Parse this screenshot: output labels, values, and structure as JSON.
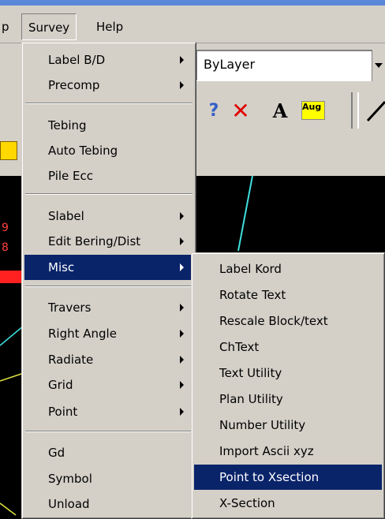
{
  "menubar": {
    "items": [
      {
        "label": "Survey"
      },
      {
        "label": "Help"
      }
    ],
    "partial_left": "p"
  },
  "toolbar": {
    "layer_value": "ByLayer",
    "aug_icon_text": "Aug"
  },
  "survey_menu": {
    "items": [
      {
        "label": "Label B/D",
        "submenu": true
      },
      {
        "label": "Precomp",
        "submenu": true
      },
      {
        "label": "Tebing",
        "submenu": false
      },
      {
        "label": "Auto Tebing",
        "submenu": false
      },
      {
        "label": "Pile Ecc",
        "submenu": false
      },
      {
        "label": "Slabel",
        "submenu": true
      },
      {
        "label": "Edit Bering/Dist",
        "submenu": true
      },
      {
        "label": "Misc",
        "submenu": true,
        "highlighted": true
      },
      {
        "label": "Travers",
        "submenu": true
      },
      {
        "label": "Right Angle",
        "submenu": true
      },
      {
        "label": "Radiate",
        "submenu": true
      },
      {
        "label": "Grid",
        "submenu": true
      },
      {
        "label": "Point",
        "submenu": true
      },
      {
        "label": "Gd",
        "submenu": false
      },
      {
        "label": "Symbol",
        "submenu": false
      },
      {
        "label": "Unload",
        "submenu": false
      }
    ]
  },
  "misc_submenu": {
    "items": [
      {
        "label": "Label Kord"
      },
      {
        "label": "Rotate Text"
      },
      {
        "label": "Rescale Block/text"
      },
      {
        "label": "ChText"
      },
      {
        "label": "Text Utility"
      },
      {
        "label": "Plan Utility"
      },
      {
        "label": "Number Utility"
      },
      {
        "label": "Import Ascii xyz"
      },
      {
        "label": "Point to Xsection",
        "highlighted": true
      },
      {
        "label": "X-Section"
      }
    ]
  },
  "colors": {
    "menu_bg": "#d4d0c8",
    "highlight": "#0a246a",
    "canvas": "#000000",
    "titlebar": "#5a87d8"
  }
}
